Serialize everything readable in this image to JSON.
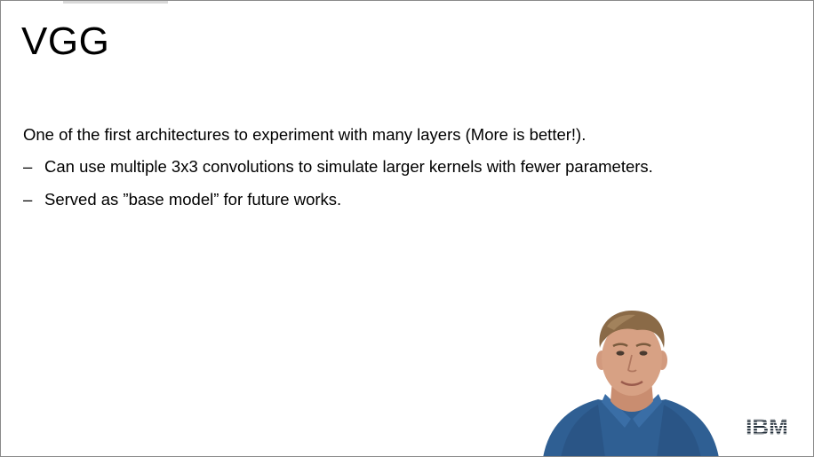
{
  "slide": {
    "title": "VGG",
    "intro": "One of the first architectures to experiment with many layers (More is better!).",
    "bullets": [
      {
        "marker": "–",
        "text": "Can use multiple 3x3 convolutions to simulate larger kernels with fewer parameters."
      },
      {
        "marker": "–",
        "text": "Served as ”base model” for future works."
      }
    ]
  },
  "presenter": {
    "icon": "presenter-video"
  },
  "logo": {
    "text": "IBM",
    "icon": "ibm-logo"
  },
  "colors": {
    "background": "#ffffff",
    "text": "#000000",
    "shirt": "#2f5f93",
    "skin": "#d7a184",
    "hair": "#8a6a47",
    "logo": "#1e2a36"
  }
}
